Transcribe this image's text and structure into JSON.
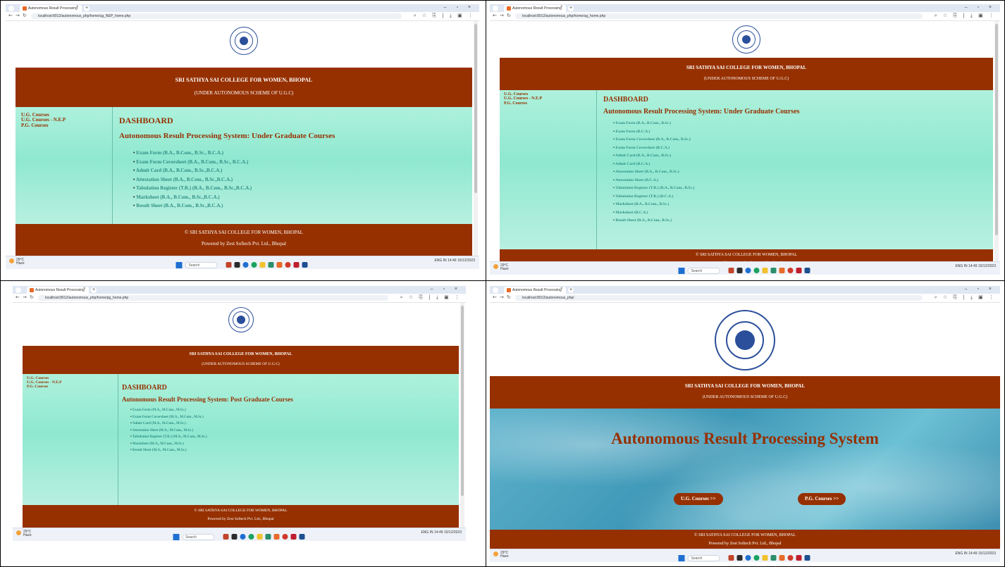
{
  "browser": {
    "tab_title": "Autonomous Result Processing",
    "close_glyph": "×",
    "new_tab_glyph": "+",
    "window_controls": "– ▫ ×",
    "toolbar_icons": "⌕ ☆ ⎘ | ⤓ ▣ ⋮"
  },
  "urls": {
    "s1": "localhost:8012/autonomous_php/home/ug_NEP_home.php",
    "s2": "localhost:8012/autonomous_php/home/ug_home.php",
    "s3": "localhost:8012/autonomous_php/home/pg_home.php",
    "s4": "localhost:8012/autonomous_php/"
  },
  "site": {
    "college_name": "SRI SATHYA SAI COLLEGE FOR WOMEN, BHOPAL",
    "scheme": "(UNDER AUTONOMOUS SCHEME OF U.G.C)",
    "footer_copyright": "© SRI SATHYA SAI COLLEGE FOR WOMEN, BHOPAL",
    "footer_powered": "Powered by Zest Softech Pvt. Ltd., Bhopal"
  },
  "sidebar": [
    "U.G. Courses",
    "U.G. Courses - N.E.P",
    "P.G. Courses"
  ],
  "dashboard_label": "DASHBOARD",
  "ug_nep": {
    "subtitle": "Autonomous Result Processing System: Under Graduate Courses",
    "links": [
      "Exam Form (B.A., B.Com., B.Sc., B.C.A.)",
      "Exam Form Coversheet (B.A., B.Com., B.Sc., B.C.A.)",
      "Admit Card (B.A., B.Com., B.Sc.,B.C.A.)",
      "Attestation Sheet (B.A., B.Com., B.Sc.,B.C.A.)",
      "Tabulation Register (T.R.) (B.A., B.Com., B.Sc.,B.C.A.)",
      "Marksheet (B.A., B.Com., B.Sc.,B.C.A.)",
      "Result Sheet (B.A., B.Com., B.Sc.,B.C.A.)"
    ]
  },
  "ug": {
    "subtitle": "Autonomous Result Processing System: Under Graduate Courses",
    "links": [
      "Exam Form (B.A., B.Com., B.Sc.)",
      "Exam Form (B.C.A.)",
      "Exam Form Coversheet (B.A., B.Com., B.Sc.)",
      "Exam Form Coversheet (B.C.A.)",
      "Admit Card (B.A., B.Com., B.Sc.)",
      "Admit Card (B.C.A.)",
      "Attestation Sheet (B.A., B.Com., B.Sc.)",
      "Attestation Sheet (B.C.A.)",
      "Tabulation Register (T.R.) (B.A., B.Com., B.Sc.)",
      "Tabulation Register (T.R.) (B.C.A.)",
      "Marksheet (B.A., B.Com., B.Sc.)",
      "Marksheet (B.C.A.)",
      "Result Sheet (B.A., B.Com., B.Sc.)"
    ]
  },
  "pg": {
    "subtitle": "Autonomous Result Processing System: Post Graduate Courses",
    "links": [
      "Exam Form (M.A., M.Com., M.Sc.)",
      "Exam Form Coversheet (M.A., M.Com., M.Sc.)",
      "Admit Card (M.A., M.Com., M.Sc.)",
      "Attestation Sheet (M.A., M.Com., M.Sc.)",
      "Tabulation Register (T.R.) (M.A., M.Com., M.Sc.)",
      "Marksheet (M.A., M.Com., M.Sc.)",
      "Result Sheet (M.A., M.Com., M.Sc.)"
    ]
  },
  "landing": {
    "title": "Autonomous Result Processing System",
    "ug_button": "U.G. Courses >>",
    "pg_button": "P.G. Courses >>"
  },
  "taskbar": {
    "temp": "29°C",
    "weather": "Haze",
    "search_placeholder": "Search",
    "tray_lang": "ENG IN",
    "time": "14:49",
    "date": "15/12/2023"
  },
  "colors": {
    "brand": "#963000",
    "mint": "#9ff0d8",
    "link": "#2f8f86"
  }
}
